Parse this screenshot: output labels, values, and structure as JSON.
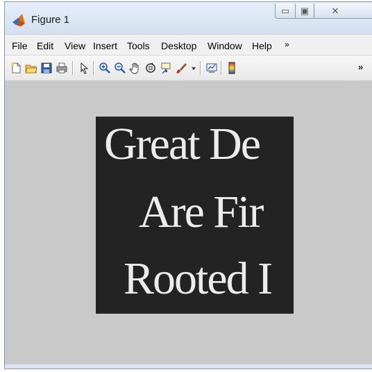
{
  "window": {
    "title": "Figure 1",
    "controls": {
      "minimize": "▭",
      "maximize": "▣",
      "close": "✕"
    }
  },
  "menubar": {
    "items": [
      "File",
      "Edit",
      "View",
      "Insert",
      "Tools",
      "Desktop",
      "Window",
      "Help"
    ],
    "overflow": "»"
  },
  "toolbar": {
    "buttons": [
      "new-figure-icon",
      "open-file-icon",
      "save-icon",
      "print-icon",
      "pointer-arrow-icon",
      "zoom-in-icon",
      "zoom-out-icon",
      "pan-hand-icon",
      "rotate-3d-icon",
      "data-cursor-icon",
      "brush-icon",
      "brush-dropdown-icon",
      "link-plot-icon",
      "colorbar-icon"
    ],
    "overflow": "»"
  },
  "figure": {
    "image_text_lines": [
      "Great De",
      "Are Fir",
      "Rooted I"
    ],
    "background_color": "#c9c9c9",
    "image_background": "#232323"
  }
}
